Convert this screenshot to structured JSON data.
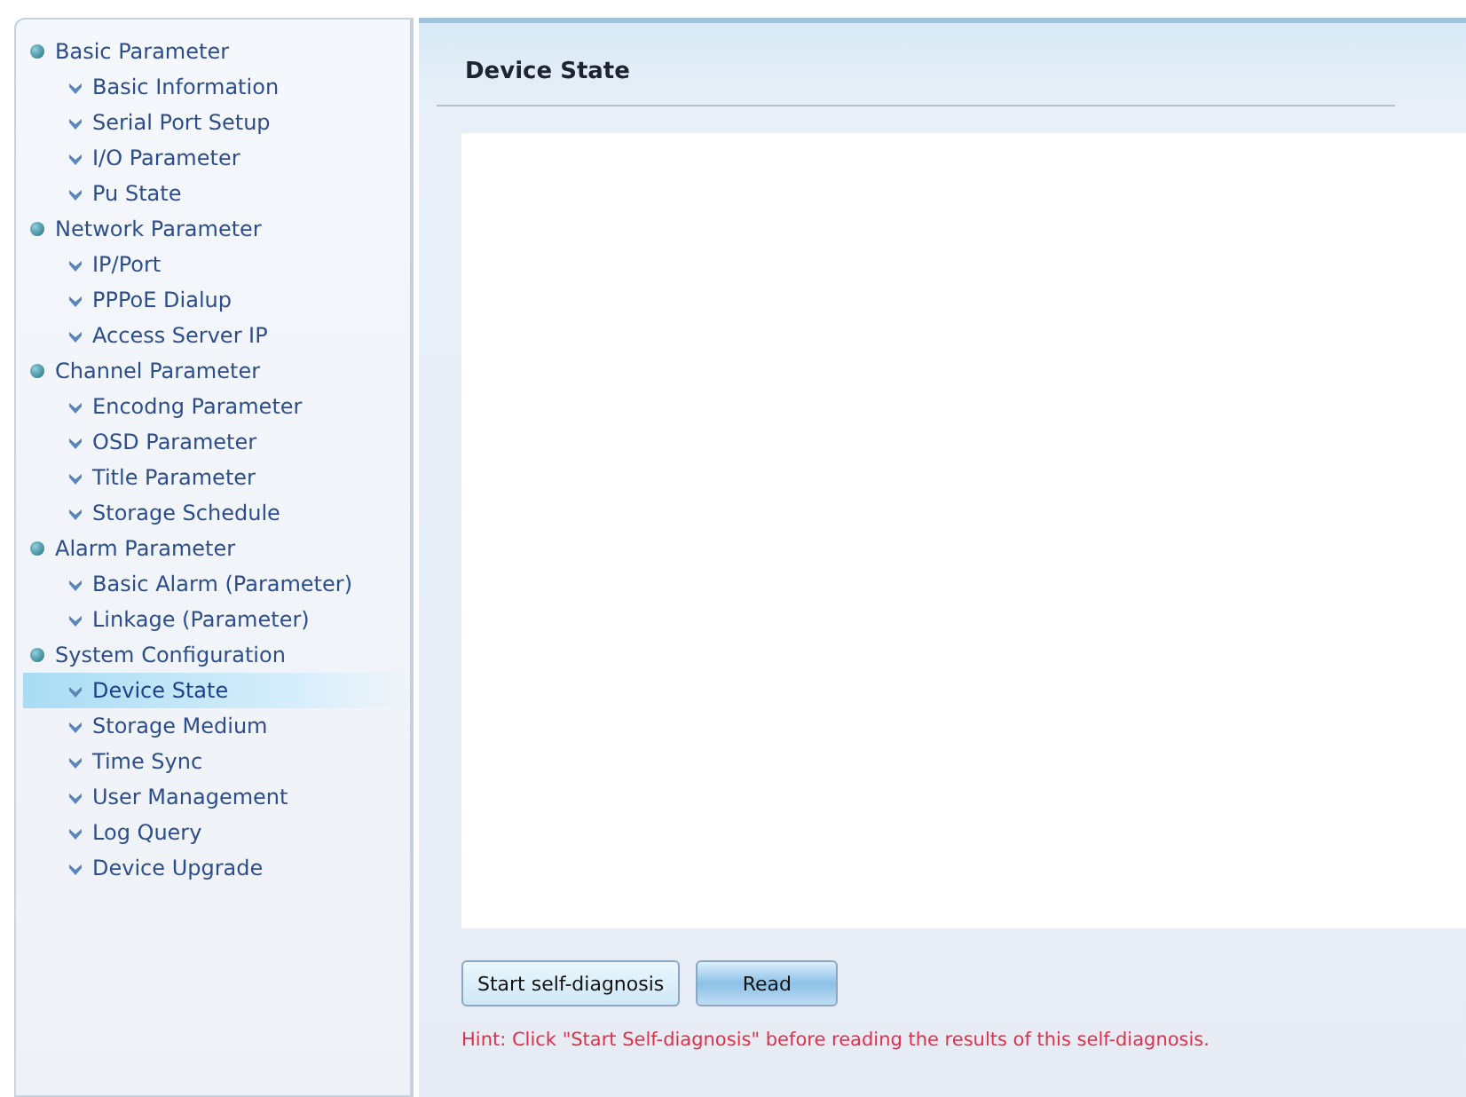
{
  "sidebar": {
    "groups": [
      {
        "label": "Basic Parameter",
        "children": [
          {
            "label": "Basic Information",
            "selected": false
          },
          {
            "label": "Serial Port Setup",
            "selected": false
          },
          {
            "label": "I/O Parameter",
            "selected": false
          },
          {
            "label": "Pu State",
            "selected": false
          }
        ]
      },
      {
        "label": "Network Parameter",
        "children": [
          {
            "label": "IP/Port",
            "selected": false
          },
          {
            "label": "PPPoE Dialup",
            "selected": false
          },
          {
            "label": "Access Server IP",
            "selected": false
          }
        ]
      },
      {
        "label": "Channel Parameter",
        "children": [
          {
            "label": "Encodng Parameter",
            "selected": false
          },
          {
            "label": "OSD Parameter",
            "selected": false
          },
          {
            "label": "Title Parameter",
            "selected": false
          },
          {
            "label": "Storage Schedule",
            "selected": false
          }
        ]
      },
      {
        "label": "Alarm Parameter",
        "children": [
          {
            "label": "Basic Alarm (Parameter)",
            "selected": false
          },
          {
            "label": "Linkage (Parameter)",
            "selected": false
          }
        ]
      },
      {
        "label": "System Configuration",
        "children": [
          {
            "label": "Device State",
            "selected": true
          },
          {
            "label": "Storage Medium",
            "selected": false
          },
          {
            "label": "Time Sync",
            "selected": false
          },
          {
            "label": "User Management",
            "selected": false
          },
          {
            "label": "Log Query",
            "selected": false
          },
          {
            "label": "Device Upgrade",
            "selected": false
          }
        ]
      }
    ]
  },
  "main": {
    "title": "Device State",
    "buttons": [
      {
        "label": "Start self-diagnosis",
        "kind": "plain"
      },
      {
        "label": "Read",
        "kind": "primary"
      }
    ],
    "hint": "Hint: Click \"Start Self-diagnosis\" before reading the results of this self-diagnosis."
  }
}
